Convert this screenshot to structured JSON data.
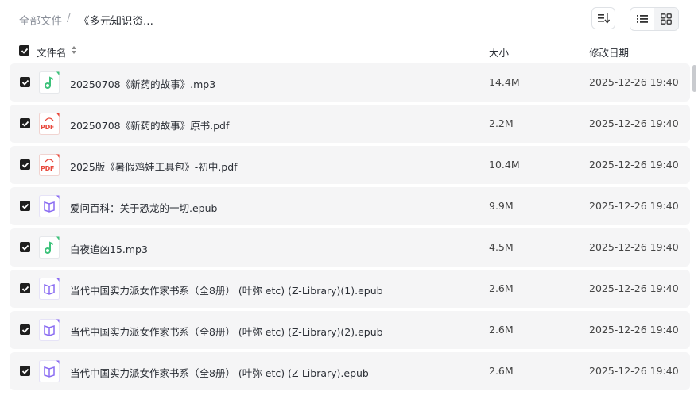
{
  "breadcrumb": {
    "root": "全部文件",
    "separator": "/",
    "current": "《多元知识资..."
  },
  "header": {
    "name": "文件名",
    "size": "大小",
    "modified": "修改日期"
  },
  "files": [
    {
      "name": "20250708《新药的故事》.mp3",
      "size": "14.4M",
      "date": "2025-12-26 19:40",
      "type": "audio",
      "badge": ""
    },
    {
      "name": "20250708《新药的故事》原书.pdf",
      "size": "2.2M",
      "date": "2025-12-26 19:40",
      "type": "pdf",
      "badge": "PDF"
    },
    {
      "name": "2025版《暑假鸡娃工具包》-初中.pdf",
      "size": "10.4M",
      "date": "2025-12-26 19:40",
      "type": "pdf",
      "badge": "PDF"
    },
    {
      "name": "爱问百科：关于恐龙的一切.epub",
      "size": "9.9M",
      "date": "2025-12-26 19:40",
      "type": "ebook",
      "badge": ""
    },
    {
      "name": "白夜追凶15.mp3",
      "size": "4.5M",
      "date": "2025-12-26 19:40",
      "type": "audio",
      "badge": ""
    },
    {
      "name": "当代中国实力派女作家书系（全8册） (叶弥 etc) (Z-Library)(1).epub",
      "size": "2.6M",
      "date": "2025-12-26 19:40",
      "type": "ebook",
      "badge": ""
    },
    {
      "name": "当代中国实力派女作家书系（全8册） (叶弥 etc) (Z-Library)(2).epub",
      "size": "2.6M",
      "date": "2025-12-26 19:40",
      "type": "ebook",
      "badge": ""
    },
    {
      "name": "当代中国实力派女作家书系（全8册） (叶弥 etc) (Z-Library).epub",
      "size": "2.6M",
      "date": "2025-12-26 19:40",
      "type": "ebook",
      "badge": ""
    }
  ],
  "icons": {
    "audio": "music-note-icon",
    "pdf": "pdf-file-icon",
    "ebook": "book-icon",
    "sort": "sort-icon",
    "list_view": "list-view-icon",
    "grid_view": "grid-view-icon",
    "checkbox": "checkbox-checked-icon"
  },
  "colors": {
    "audio": "#3cc27a",
    "pdf": "#e8473b",
    "ebook": "#8a6cf2",
    "checkbox": "#1f1f1f",
    "row_bg": "#f5f5f6"
  }
}
